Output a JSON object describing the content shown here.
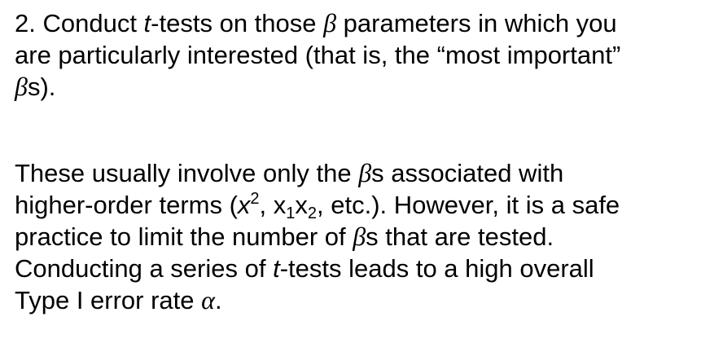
{
  "point2": {
    "line1": {
      "prefix": "2. Conduct ",
      "t": "t",
      "mid": "-tests on those ",
      "beta": "β",
      "suffix": " parameters in which you"
    },
    "line2": "are particularly interested (that is, the “most important”",
    "line3": {
      "beta": "β",
      "suffix": "s)."
    }
  },
  "note": {
    "line1": {
      "prefix": "These usually involve only the ",
      "beta": "β",
      "suffix": "s associated with"
    },
    "line2": {
      "prefix": "higher-order terms (",
      "x": "x",
      "sq": "2",
      "sep": ", x",
      "sub1": "1",
      "x2": "x",
      "sub2": "2",
      "suffix": ", etc.). However, it is a safe"
    },
    "line3": {
      "prefix": "practice to limit the number of ",
      "beta": "β",
      "suffix": "s that are tested."
    },
    "line4": {
      "prefix": "Conducting a series of ",
      "t": "t",
      "suffix": "-tests leads to a high overall"
    },
    "line5": {
      "prefix": "Type I error rate ",
      "alpha": "α",
      "suffix": "."
    }
  }
}
